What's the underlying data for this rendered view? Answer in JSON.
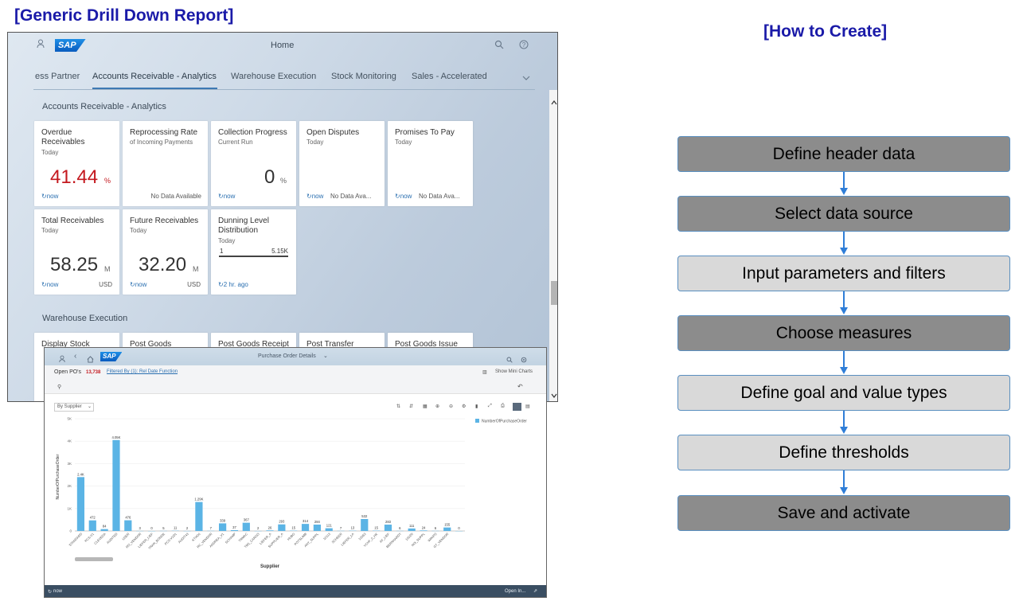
{
  "slide": {
    "left_title": "[Generic Drill Down Report]",
    "right_title": "[How to Create]"
  },
  "launchpad": {
    "header": {
      "sap_logo": "SAP",
      "title": "Home",
      "icons": [
        "user-icon",
        "search-icon",
        "help-icon"
      ]
    },
    "tabs": [
      {
        "label": "ess Partner"
      },
      {
        "label": "Accounts Receivable - Analytics",
        "active": true
      },
      {
        "label": "Warehouse Execution"
      },
      {
        "label": "Stock Monitoring"
      },
      {
        "label": "Sales - Accelerated"
      }
    ],
    "groups": [
      {
        "title": "Accounts Receivable - Analytics",
        "tiles": [
          {
            "title": "Overdue Receivables",
            "subtitle": "Today",
            "value": "41.44",
            "unit": "%",
            "value_color": "#c4191f",
            "footer": "now",
            "footer_right": ""
          },
          {
            "title": "Reprocessing Rate",
            "subtitle": "of Incoming Payments",
            "value": "",
            "unit": "",
            "footer": "",
            "footer_right": "No Data Available"
          },
          {
            "title": "Collection Progress",
            "subtitle": "Current Run",
            "value": "0",
            "unit": "%",
            "footer": "now",
            "footer_right": ""
          },
          {
            "title": "Open Disputes",
            "subtitle": "Today",
            "value": "",
            "unit": "",
            "footer": "now",
            "footer_right": "No Data Ava..."
          },
          {
            "title": "Promises To Pay",
            "subtitle": "Today",
            "value": "",
            "unit": "",
            "footer": "now",
            "footer_right": "No Data Ava..."
          },
          {
            "title": "Total Receivables",
            "subtitle": "Today",
            "value": "58.25",
            "unit": "M",
            "footer": "now",
            "footer_right": "USD"
          },
          {
            "title": "Future Receivables",
            "subtitle": "Today",
            "value": "32.20",
            "unit": "M",
            "footer": "now",
            "footer_right": "USD"
          },
          {
            "title": "Dunning Level Distribution",
            "subtitle": "Today",
            "bar_label": "1",
            "bar_value": "5.15K",
            "value": "",
            "unit": "",
            "footer": "2 hr. ago",
            "footer_right": ""
          }
        ]
      },
      {
        "title": "Warehouse Execution",
        "tiles": [
          {
            "title": "Display Stock"
          },
          {
            "title": "Post Goods"
          },
          {
            "title": "Post Goods Receipt"
          },
          {
            "title": "Post Transfer"
          },
          {
            "title": "Post Goods Issue"
          }
        ]
      }
    ]
  },
  "drilldown": {
    "header": {
      "sap_logo": "SAP",
      "title": "Purchase Order Details",
      "icons": [
        "user-icon",
        "back-icon",
        "home-icon",
        "search-icon",
        "settings-icon"
      ]
    },
    "subheader": {
      "label": "Open PO's",
      "count": "13,738",
      "filter": "Filtered By (1): Rel Date Function",
      "mini_charts": "Show Mini Charts"
    },
    "dimension_select": "By Supplier",
    "footer": {
      "left": "now",
      "right": "Open In..."
    }
  },
  "chart_data": {
    "type": "bar",
    "xlabel": "Supplier",
    "ylabel": "NumberOfPurchaseOrder",
    "legend": [
      "NumberOfPurchaseOrder"
    ],
    "yticks": [
      "0",
      "1K",
      "2K",
      "3K",
      "4K",
      "5K"
    ],
    "ylim": [
      0,
      5000
    ],
    "color": "#5bb4e5",
    "categories": [
      "STANDARD",
      "PCS-V1",
      "CLEVEDA",
      "AUDITED",
      "USER",
      "RO_VENDOR",
      "LIEFER_LIEF",
      "TRAN_BONDE",
      "PCS-V1D1",
      "AUDIT43",
      "KTI400",
      "RC_VENDOR",
      "ANDREA_V1",
      "SCHAMP",
      "TRMAC",
      "TM1_CARGO",
      "LIEFER_A",
      "SUPPLIER_A",
      "HUBG",
      "POTSLIMB",
      "ANT_SUPPL",
      "10113",
      "SCHEER",
      "LIEFER_LA",
      "10063",
      "YCHF_0_HK",
      "AF_LIEF",
      "BERNHARDT",
      "1002N",
      "NIX_SUPPL",
      "WIKIPS",
      "GT_VENDOR"
    ],
    "values": [
      2400,
      472,
      84,
      4050,
      476,
      3,
      0,
      5,
      11,
      2,
      1290,
      7,
      339,
      37,
      367,
      2,
      26,
      293,
      15,
      314,
      284,
      121,
      7,
      13,
      532,
      15,
      283,
      6,
      111,
      24,
      6,
      155,
      0
    ],
    "data_labels": [
      "2.4K",
      "472",
      "84",
      "4.05K",
      "476",
      "3",
      "0",
      "5",
      "11",
      "2",
      "1.29K",
      "7",
      "339",
      "37",
      "367",
      "2",
      "26",
      "293",
      "15",
      "314",
      "284",
      "121",
      "7",
      "13",
      "532",
      "15",
      "283",
      "6",
      "111",
      "24",
      "6",
      "155",
      "0"
    ]
  },
  "flow": {
    "steps": [
      {
        "label": "Define header data",
        "style": "dark"
      },
      {
        "label": "Select data source",
        "style": "dark"
      },
      {
        "label": "Input parameters and filters",
        "style": "light"
      },
      {
        "label": "Choose measures",
        "style": "dark"
      },
      {
        "label": "Define goal and value types",
        "style": "light"
      },
      {
        "label": "Define thresholds",
        "style": "light"
      },
      {
        "label": "Save and activate",
        "style": "dark"
      }
    ]
  }
}
